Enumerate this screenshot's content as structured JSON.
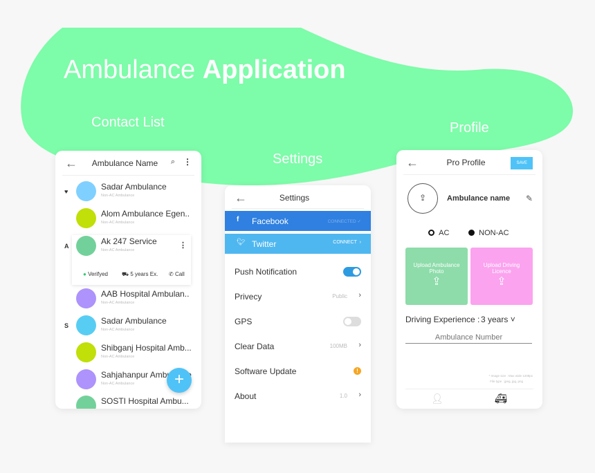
{
  "header": {
    "title_light": "Ambulance",
    "title_bold": "Application"
  },
  "sections": {
    "contacts": "Contact List",
    "settings": "Settings",
    "profile": "Profile"
  },
  "colors": {
    "blob": "#7dfca9",
    "facebook": "#2f80e0",
    "twitter": "#4fb7f0",
    "accent": "#4fc3f7"
  },
  "contact_list": {
    "title": "Ambulance Name",
    "back_icon": "arrow-left-icon",
    "search_icon": "search-icon",
    "menu_icon": "more-vertical-icon",
    "items": [
      {
        "name": "Sadar Ambulance",
        "sub": "Non-AC Ambulance",
        "color": "#7fd0ff",
        "letter": "♥"
      },
      {
        "name": "Alom Ambulance Egen..",
        "sub": "Non-AC Ambulance",
        "color": "#c1df08",
        "letter": ""
      },
      {
        "name": "Ak 247 Service",
        "sub": "Non-AC Ambulance",
        "color": "#72d19a",
        "letter": "A"
      },
      {
        "name": "AAB Hospital Ambulan..",
        "sub": "Non-AC Ambulance",
        "color": "#ad93fb",
        "letter": ""
      },
      {
        "name": "Sadar Ambulance",
        "sub": "Non-AC Ambulance",
        "color": "#58cdf4",
        "letter": "S"
      },
      {
        "name": "Shibganj Hospital Amb...",
        "sub": "Non-AC Ambulance",
        "color": "#c1df08",
        "letter": ""
      },
      {
        "name": "Sahjahanpur Ambulance",
        "sub": "Non-AC Ambulance",
        "color": "#ad93fb",
        "letter": ""
      },
      {
        "name": "SOSTI Hospital Ambu...",
        "sub": "",
        "color": "#72d19a",
        "letter": ""
      }
    ],
    "expanded": {
      "verified": "Verifyed",
      "experience": "5 years Ex.",
      "call": "Call"
    },
    "fab": "+"
  },
  "settings": {
    "title": "Settings",
    "facebook": {
      "label": "Facebook",
      "status": "CONNECTED"
    },
    "twitter": {
      "label": "Twitter",
      "status": "CONNECT"
    },
    "rows": [
      {
        "label": "Push Notification",
        "toggle": true
      },
      {
        "label": "Privecy",
        "value": "Public"
      },
      {
        "label": "GPS",
        "toggle": false
      },
      {
        "label": "Clear Data",
        "value": "100MB"
      },
      {
        "label": "Software Update",
        "alert": "!"
      },
      {
        "label": "About",
        "value": "1.0"
      }
    ]
  },
  "profile": {
    "title": "Pro Profile",
    "save": "SAVE",
    "name": "Ambulance name",
    "ac": "AC",
    "nonac": "NON-AC",
    "upload_photo": "Upload Ambulance Photo",
    "upload_licence": "Upload Driving Licence",
    "exp_label": "Driving Experience :",
    "exp_value": "3 years",
    "number_placeholder": "Ambulance Number",
    "note1": "* Image size : Max wide 1208px",
    "note2": "File type : jpeg, jpg, png"
  }
}
